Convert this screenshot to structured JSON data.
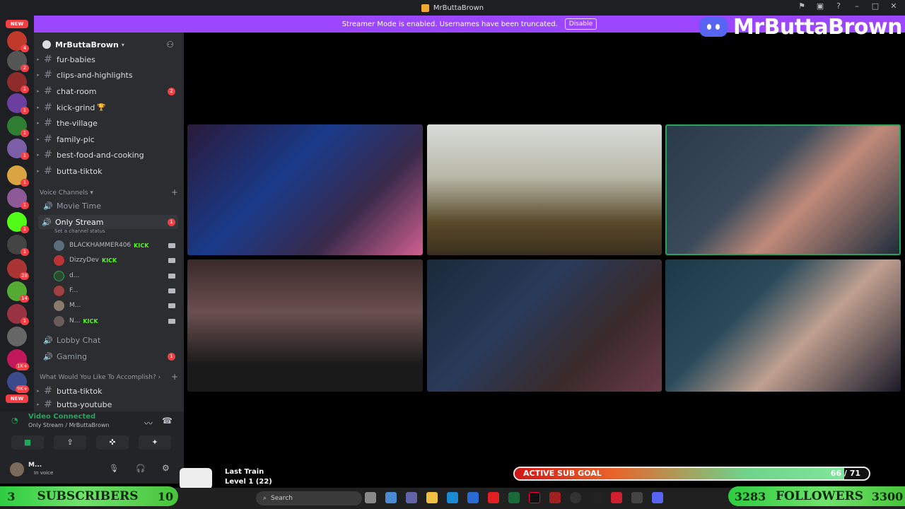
{
  "window": {
    "title": "MrButtaBrown"
  },
  "banner": {
    "message": "Streamer Mode is enabled. Usernames have been truncated.",
    "disable_label": "Disable"
  },
  "brand": {
    "name": "MrButtaBrown"
  },
  "server": {
    "name": "MrButtaBrown"
  },
  "text_channels": [
    {
      "name": "fur-babies"
    },
    {
      "name": "clips-and-highlights"
    },
    {
      "name": "chat-room",
      "badge": "2"
    },
    {
      "name": "kick-grind"
    },
    {
      "name": "the-village"
    },
    {
      "name": "family-pic"
    },
    {
      "name": "best-food-and-cooking"
    },
    {
      "name": "butta-tiktok"
    }
  ],
  "voice_category": {
    "label": "Voice Channels"
  },
  "voice_channels": {
    "movie_time": "Movie Time",
    "only_stream": "Only Stream",
    "only_stream_status": "Set a channel status",
    "only_stream_badge": "1",
    "lobby_chat": "Lobby Chat",
    "gaming": "Gaming",
    "gaming_badge": "1"
  },
  "voice_users": [
    {
      "name": "BLACKHAMMER406",
      "kick": "KICK"
    },
    {
      "name": "DizzyDev",
      "kick": "KICK"
    },
    {
      "name": "d..."
    },
    {
      "name": "F..."
    },
    {
      "name": "M..."
    },
    {
      "name": "N...",
      "kick": "KICK"
    }
  ],
  "category2": {
    "label": "What Would You Like To Accomplish?"
  },
  "channels2": [
    {
      "name": "butta-tiktok"
    },
    {
      "name": "butta-youtube"
    }
  ],
  "voice_panel": {
    "status": "Video Connected",
    "location": "Only Stream / MrButtaBrown"
  },
  "user_panel": {
    "name": "M...",
    "status": "In voice"
  },
  "rail": {
    "new_label": "NEW"
  },
  "overlay": {
    "subs_current": "3",
    "subs_label": "SUBSCRIBERS",
    "subs_goal": "10",
    "followers_current": "3283",
    "followers_label": "FOLLOWERS",
    "followers_goal": "3300",
    "sub_goal_label": "ACTIVE SUB GOAL",
    "sub_goal_value": "66 / 71",
    "sub_goal_fraction": 0.93,
    "now_playing_title": "Last Train",
    "now_playing_level": "Level 1 (22)"
  },
  "taskbar": {
    "search_placeholder": "Search"
  },
  "colors": {
    "banner": "#9b46ff",
    "speaking": "#23a55a",
    "badge": "#f23f43",
    "kick": "#53fc18"
  }
}
